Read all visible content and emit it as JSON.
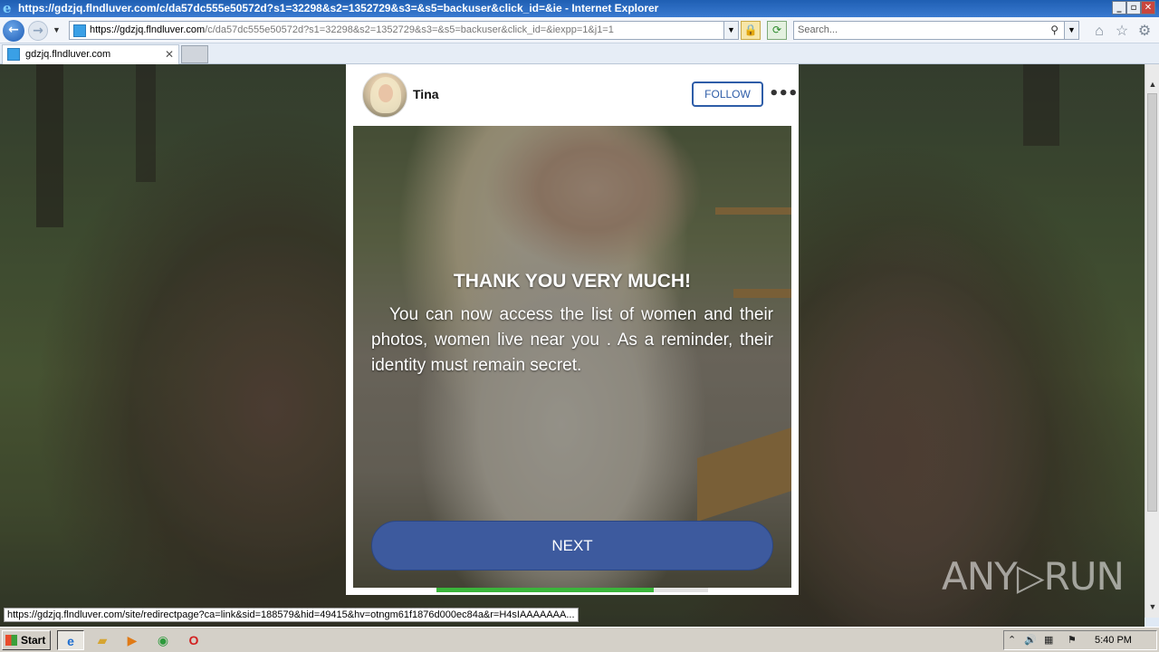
{
  "window": {
    "title": "https://gdzjq.flndluver.com/c/da57dc555e50572d?s1=32298&s2=1352729&s3=&s5=backuser&click_id=&ie - Internet Explorer",
    "controls": {
      "minimize": "_",
      "maximize": "▫",
      "close": "✕"
    }
  },
  "toolbar": {
    "url_domain": "https://gdzjq.flndluver.com",
    "url_path": "/c/da57dc555e50572d?s1=32298&s2=1352729&s3=&s5=backuser&click_id=&iexpp=1&j1=1",
    "search_placeholder": "Search...",
    "icons": [
      "back-arrow-icon",
      "forward-arrow-icon",
      "lock-icon",
      "refresh-icon",
      "search-icon",
      "home-icon",
      "star-icon",
      "gear-icon"
    ]
  },
  "tabs": [
    {
      "label": "gdzjq.flndluver.com",
      "active": true
    }
  ],
  "card": {
    "username": "Tina",
    "follow_label": "FOLLOW",
    "more_label": "•••",
    "title": "THANK YOU VERY MUCH!",
    "body": "You can now access the list of women and their photos, women live near you . As a reminder, their identity must remain secret.",
    "next_label": "NEXT",
    "progress": 0.8
  },
  "status_link": "https://gdzjq.flndluver.com/site/redirectpage?ca=link&sid=188579&hid=49415&hv=otngm61f1876d000ec84a&r=H4sIAAAAAAA...",
  "watermark": {
    "left": "ANY",
    "play": "▷",
    "right": "RUN"
  },
  "taskbar": {
    "start_label": "Start",
    "apps": [
      "internet-explorer",
      "windows-explorer",
      "media-player",
      "chrome",
      "opera"
    ],
    "clock": "5:40 PM"
  }
}
